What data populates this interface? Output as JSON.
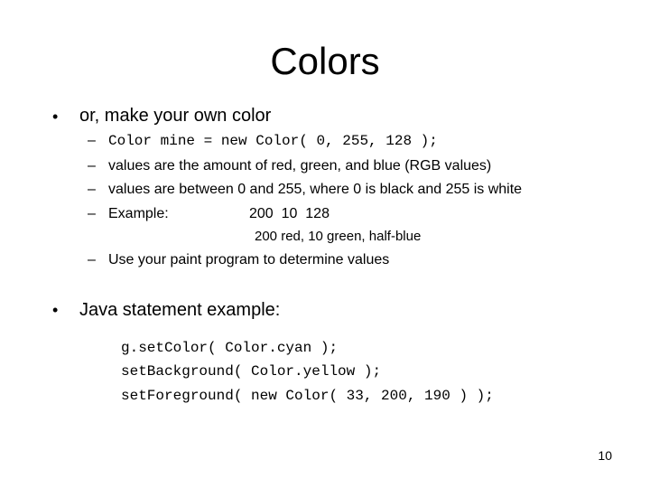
{
  "slide": {
    "title": "Colors",
    "bullets": [
      {
        "marker": "•",
        "text": "or, make your own color",
        "sub_items": [
          {
            "marker": "–",
            "text": "Color mine = new Color( 0, 255, 128 );",
            "monospace": true
          },
          {
            "marker": "–",
            "text": "values are the amount of red, green, and blue (RGB values)"
          },
          {
            "marker": "–",
            "text": "values are between 0 and 255, where 0 is black and 255 is white"
          },
          {
            "marker": "–",
            "text": "Example:",
            "value": "200  10  128",
            "note": "200 red, 10 green, half-blue"
          },
          {
            "marker": "–",
            "text": "Use your paint program to determine values"
          }
        ]
      },
      {
        "marker": "•",
        "text": "Java statement example:",
        "code_lines": [
          "g.setColor( Color.cyan );",
          "setBackground( Color.yellow );",
          "setForeground( new Color( 33, 200, 190 ) );"
        ]
      }
    ],
    "page_number": "10"
  }
}
